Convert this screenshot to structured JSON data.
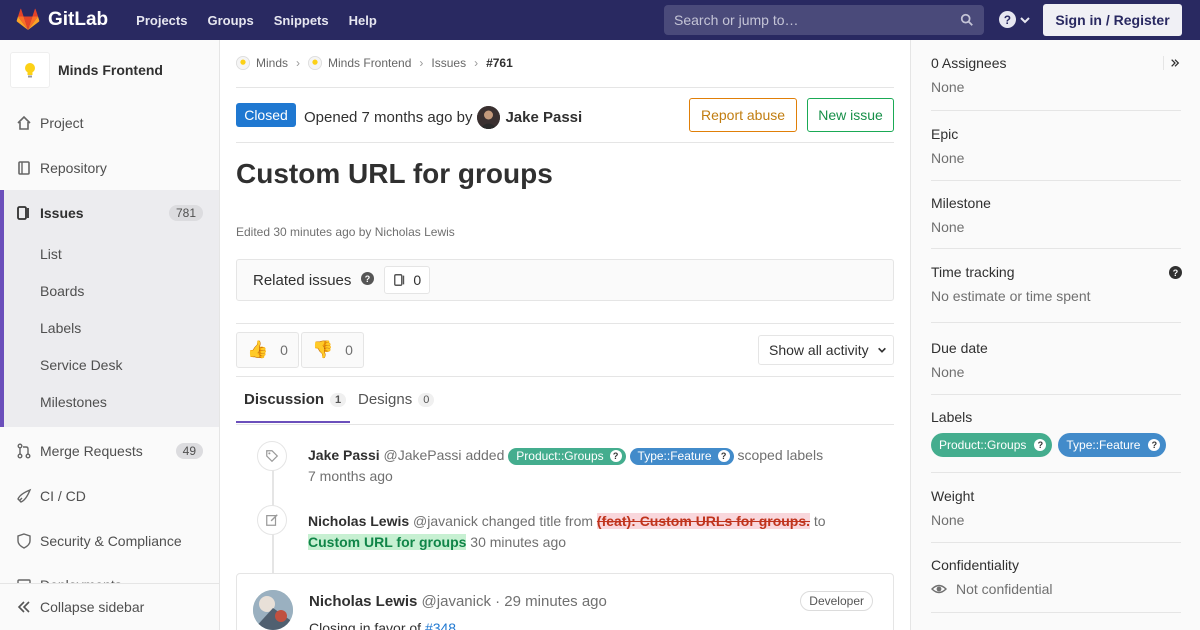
{
  "topnav": {
    "brand": "GitLab",
    "links": [
      "Projects",
      "Groups",
      "Snippets",
      "Help"
    ],
    "search_placeholder": "Search or jump to…",
    "signin_label": "Sign in / Register"
  },
  "sidebar": {
    "project_name": "Minds Frontend",
    "items": {
      "project": "Project",
      "repository": "Repository",
      "issues": "Issues",
      "issues_count": "781",
      "merge_requests": "Merge Requests",
      "merge_requests_count": "49",
      "cicd": "CI / CD",
      "security": "Security & Compliance",
      "deployments_partial": "Deployments"
    },
    "issue_subitems": [
      "List",
      "Boards",
      "Labels",
      "Service Desk",
      "Milestones"
    ],
    "collapse_label": "Collapse sidebar"
  },
  "breadcrumb": [
    "Minds",
    "Minds Frontend",
    "Issues",
    "#761"
  ],
  "issue": {
    "status": "Closed",
    "opened_text": "Opened 7 months ago by",
    "author": "Jake Passi",
    "report_abuse": "Report abuse",
    "new_issue": "New issue",
    "title": "Custom URL for groups",
    "edited": "Edited 30 minutes ago by Nicholas Lewis",
    "related_label": "Related issues",
    "related_count": "0",
    "thumbs_up": "0",
    "thumbs_down": "0",
    "activity_filter": "Show all activity"
  },
  "tabs": {
    "discussion": "Discussion",
    "discussion_count": "1",
    "designs": "Designs",
    "designs_count": "0"
  },
  "notes": [
    {
      "author": "Jake Passi",
      "handle": "@JakePassi",
      "action": "added",
      "labels": [
        "Product::Groups",
        "Type::Feature"
      ],
      "tail": "scoped labels",
      "time": "7 months ago"
    },
    {
      "author": "Nicholas Lewis",
      "handle": "@javanick",
      "action": "changed title from",
      "old_title": "(feat): Custom URLs for groups.",
      "to": "to",
      "new_title": "Custom URL for groups",
      "time": "30 minutes ago"
    }
  ],
  "comment": {
    "author": "Nicholas Lewis",
    "meta": "@javanick · 29 minutes ago",
    "role": "Developer",
    "body": "Closing in favor of",
    "ref": "#348"
  },
  "right": {
    "assignees": "0 Assignees",
    "assignees_val": "None",
    "epic": "Epic",
    "epic_val": "None",
    "milestone": "Milestone",
    "milestone_val": "None",
    "time_tracking": "Time tracking",
    "time_tracking_val": "No estimate or time spent",
    "due_date": "Due date",
    "due_date_val": "None",
    "labels": "Labels",
    "label1": "Product::Groups",
    "label2": "Type::Feature",
    "weight": "Weight",
    "weight_val": "None",
    "confidentiality": "Confidentiality",
    "confidentiality_val": "Not confidential"
  },
  "colors": {
    "nav_bg": "#292961",
    "label_groups": "#44ad8e",
    "label_feature": "#428bca",
    "closed_badge": "#1f78d1",
    "active_accent": "#6b4fbb"
  }
}
